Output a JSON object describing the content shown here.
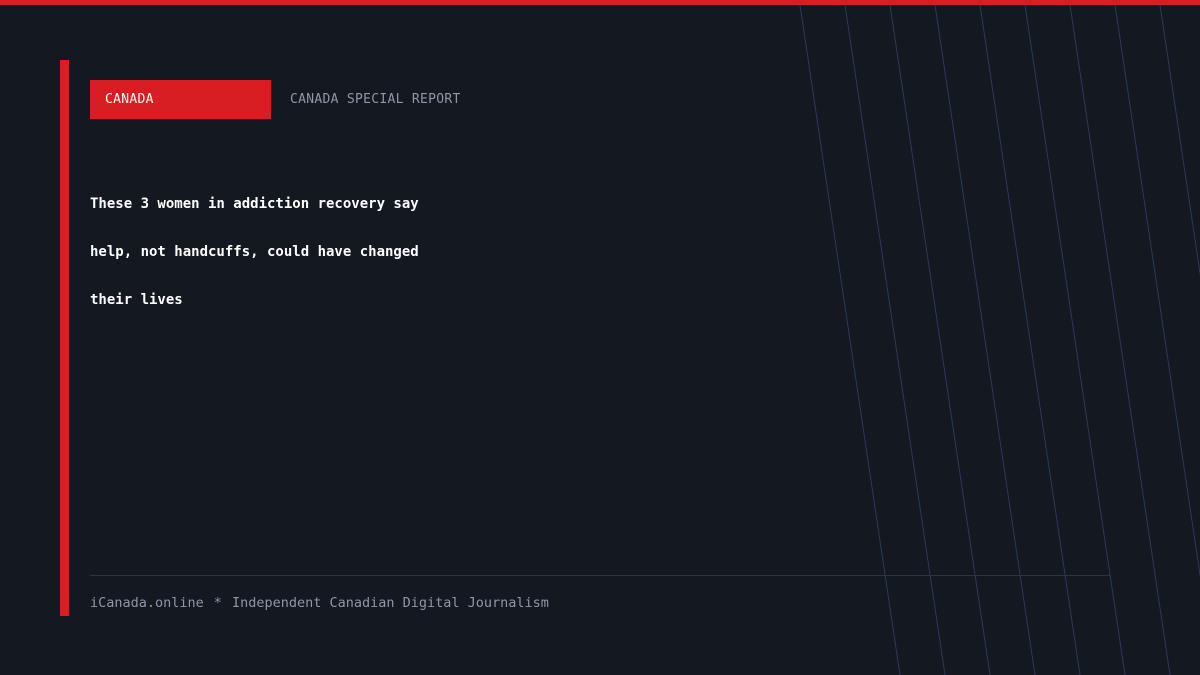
{
  "category": "CANADA",
  "report_label": "CANADA SPECIAL REPORT",
  "headline": {
    "lines": [
      "These 3 women in addiction recovery say",
      "help, not handcuffs, could have changed",
      "their lives"
    ]
  },
  "footer": {
    "site": "iCanada.online",
    "separator": "*",
    "tagline": "Independent Canadian Digital Journalism"
  },
  "colors": {
    "background": "#131821",
    "accent": "#d81e22",
    "muted_text": "#8f97a6",
    "pattern_lines": "#2b3a5a"
  }
}
